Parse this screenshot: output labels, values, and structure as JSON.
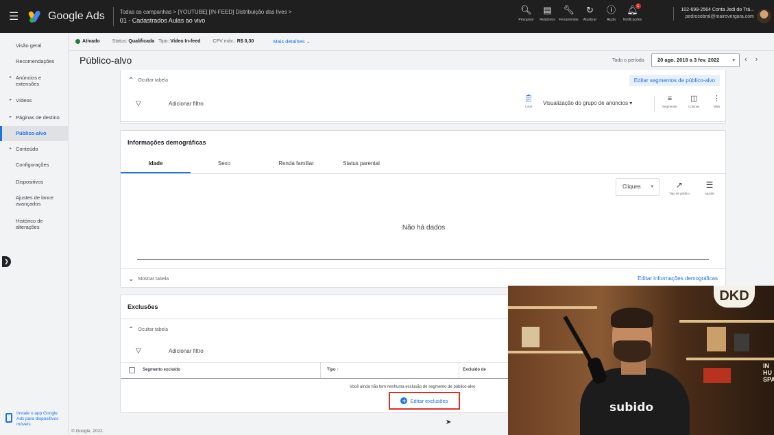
{
  "topbar": {
    "menu_icon": "hamburger-icon",
    "app_name": "Google Ads",
    "breadcrumb": "Todas as campanhas  >  [YOUTUBE] [IN-FEED] Distribuição das lives  >",
    "campaign_title": "01 - Cadastrados Aulas ao vivo",
    "tools": [
      {
        "icon": "search-icon",
        "label": "Pesquisar"
      },
      {
        "icon": "reports-icon",
        "label": "Relatórios"
      },
      {
        "icon": "wrench-icon",
        "label": "Ferramentas"
      },
      {
        "icon": "refresh-icon",
        "label": "Atualizar"
      },
      {
        "icon": "help-icon",
        "label": "Ajuda"
      },
      {
        "icon": "bell-icon",
        "label": "Notificações",
        "badge": "1"
      }
    ],
    "account_line": "102-699-2564 Conta Jedi do Trá...",
    "account_email": "pedrosobral@mairovergara.com"
  },
  "sidebar": {
    "items": [
      {
        "label": "Visão geral"
      },
      {
        "label": "Recomendações"
      },
      {
        "label": "Anúncios e extensões"
      },
      {
        "label": "Vídeos"
      },
      {
        "label": "Páginas de destino"
      },
      {
        "label": "Público-alvo",
        "active": true
      },
      {
        "label": "Conteúdo"
      },
      {
        "label": "Configurações"
      },
      {
        "label": "Dispositivos"
      },
      {
        "label": "Ajustes de lance avançados"
      },
      {
        "label": "Histórico de alterações"
      }
    ],
    "install_text": "Instale o app Google Ads para dispositivos móveis",
    "copyright": "© Google, 2022."
  },
  "status": {
    "enabled": "Ativado",
    "status_label": "Status:",
    "status_value": "Qualificada",
    "type_label": "Tipo:",
    "type_value": "Vídeo In-feed",
    "cpv_label": "CPV máx.:",
    "cpv_value": "R$ 0,30",
    "more_details": "Mais detalhes"
  },
  "page": {
    "title": "Público-alvo",
    "period_label": "Todo o período",
    "date_range": "20 ago. 2018 a 3 fev. 2022"
  },
  "audience_card": {
    "hide_table": "Ocultar tabela",
    "edit_segments": "Editar segmentos de público-alvo",
    "add_filter": "Adicionar filtro",
    "copy_label": "Colar",
    "view_select": "Visualização do grupo de anúncios",
    "segment_label": "Segmentar",
    "columns_label": "Colunas",
    "more_label": "Mais"
  },
  "demographics": {
    "title": "Informações demográficas",
    "tabs": [
      "Idade",
      "Sexo",
      "Renda familiar",
      "Status parental"
    ],
    "metric": "Cliques",
    "chart_type_label": "Tipo de gráfico",
    "adjust_label": "Ajustar",
    "no_data": "Não há dados",
    "show_table": "Mostrar tabela",
    "edit_link": "Editar informações demográficas"
  },
  "exclusions": {
    "title": "Exclusões",
    "hide_table": "Ocultar tabela",
    "add_filter": "Adicionar filtro",
    "columns": [
      "Segmento excluído",
      "Tipo ↑",
      "Excluído de"
    ],
    "empty_message": "Você ainda não tem nenhuma exclusão de segmento de público-alvo",
    "edit_button": "Editar exclusões"
  },
  "webcam": {
    "shirt_text": "subido",
    "sign_text": "DKD",
    "right_text": "IN\nHU\nSPA"
  }
}
